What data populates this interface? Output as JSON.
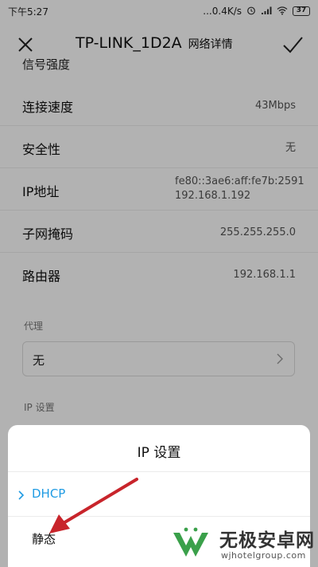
{
  "status_bar": {
    "time": "下午5:27",
    "network_speed": "...0.4K/s",
    "battery": "37"
  },
  "header": {
    "title": "TP-LINK_1D2A",
    "subtitle": "网络详情"
  },
  "details": {
    "cutoff_label": "信号强度",
    "rows": [
      {
        "label": "连接速度",
        "value": "43Mbps"
      },
      {
        "label": "安全性",
        "value": "无"
      },
      {
        "label": "IP地址",
        "value_line1": "fe80::3ae6:aff:fe7b:2591",
        "value_line2": "192.168.1.192"
      },
      {
        "label": "子网掩码",
        "value": "255.255.255.0"
      },
      {
        "label": "路由器",
        "value": "192.168.1.1"
      }
    ]
  },
  "proxy": {
    "section_label": "代理",
    "value": "无"
  },
  "ip_settings_section_label": "IP 设置",
  "sheet": {
    "title": "IP  设置",
    "options": [
      {
        "label": "DHCP",
        "selected": true
      },
      {
        "label": "静态",
        "selected": false
      }
    ]
  },
  "watermark": {
    "brand": "无极安卓网",
    "url": "wjhotelgroup.com"
  },
  "colors": {
    "accent": "#1f9be3",
    "annotation": "#c8242b"
  }
}
